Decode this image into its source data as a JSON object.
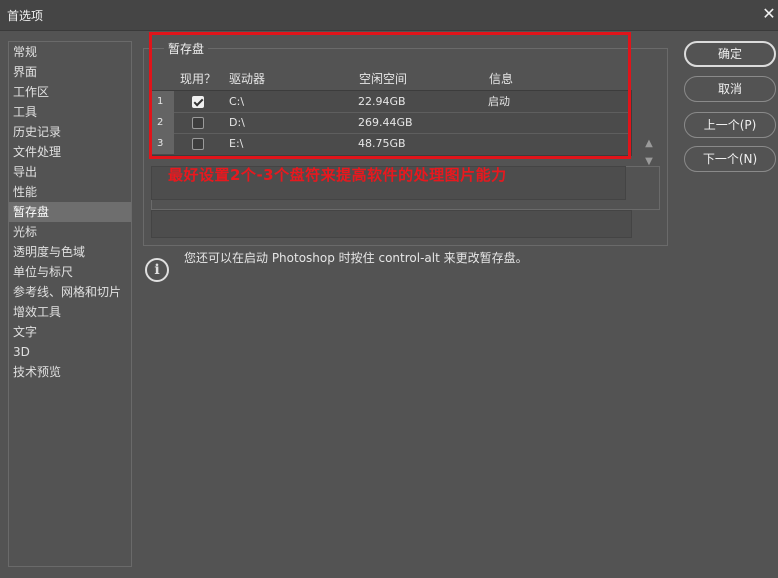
{
  "window": {
    "title": "首选项",
    "close_glyph": "✕"
  },
  "sidebar": {
    "items": [
      {
        "label": "常规"
      },
      {
        "label": "界面"
      },
      {
        "label": "工作区"
      },
      {
        "label": "工具"
      },
      {
        "label": "历史记录"
      },
      {
        "label": "文件处理"
      },
      {
        "label": "导出"
      },
      {
        "label": "性能"
      },
      {
        "label": "暂存盘",
        "active": true
      },
      {
        "label": "光标"
      },
      {
        "label": "透明度与色域"
      },
      {
        "label": "单位与标尺"
      },
      {
        "label": "参考线、网格和切片"
      },
      {
        "label": "增效工具"
      },
      {
        "label": "文字"
      },
      {
        "label": "3D"
      },
      {
        "label": "技术预览"
      }
    ]
  },
  "scratch": {
    "group_title": "暂存盘",
    "columns": [
      "现用？",
      "驱动器",
      "空闲空间",
      "信息"
    ],
    "rows": [
      {
        "num": "1",
        "checked": true,
        "drive": "C:\\",
        "free": "22.94GB",
        "info": "启动"
      },
      {
        "num": "2",
        "checked": false,
        "drive": "D:\\",
        "free": "269.44GB",
        "info": ""
      },
      {
        "num": "3",
        "checked": false,
        "drive": "E:\\",
        "free": "48.75GB",
        "info": ""
      }
    ],
    "scroll_up_glyph": "▲",
    "scroll_down_glyph": "▼"
  },
  "annotation": {
    "text": "最好设置2个-3个盘符来提高软件的处理图片能力",
    "color": "#e8181e"
  },
  "info": {
    "icon_glyph": "i",
    "text": "您还可以在启动 Photoshop 时按住 control-alt 来更改暂存盘。"
  },
  "buttons": {
    "ok": "确定",
    "cancel": "取消",
    "prev": "上一个(P)",
    "next": "下一个(N)"
  },
  "colors": {
    "background": "#535353",
    "titlebar": "#454545",
    "highlight": "#e0141a"
  }
}
